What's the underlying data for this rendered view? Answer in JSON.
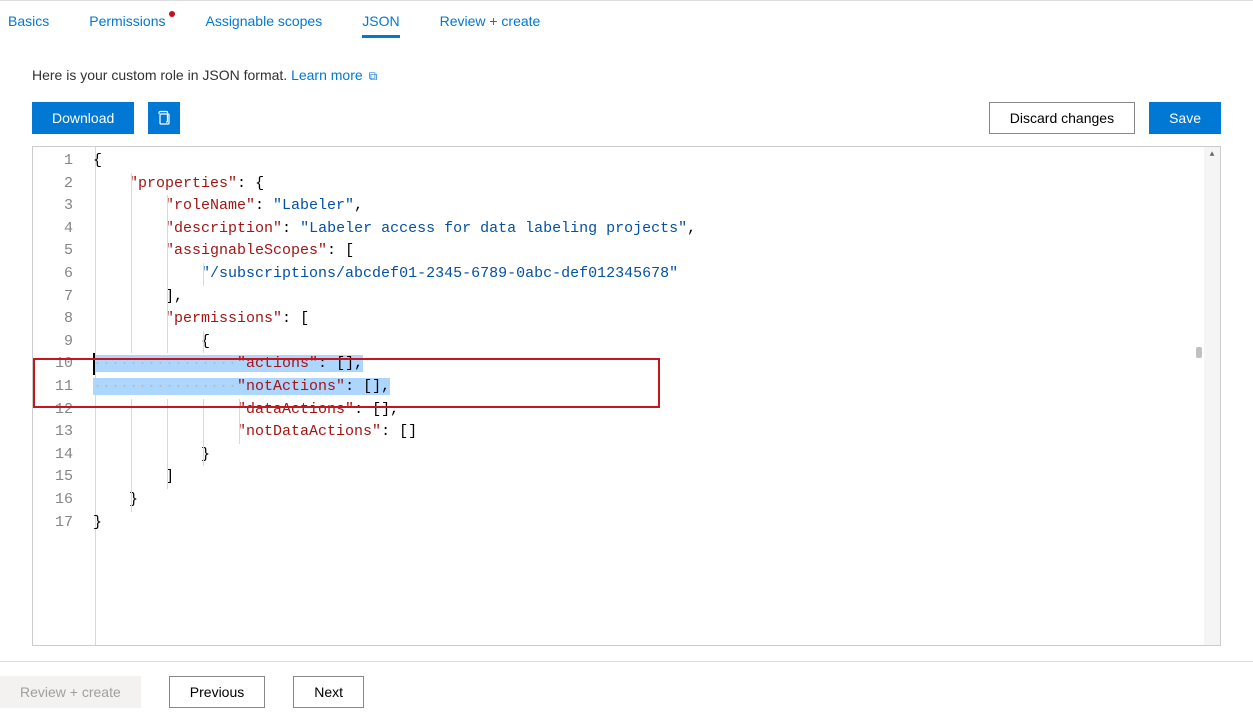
{
  "tabs": {
    "basics": "Basics",
    "permissions": "Permissions",
    "assignable_scopes": "Assignable scopes",
    "json": "JSON",
    "review_create": "Review + create"
  },
  "subheading": {
    "text": "Here is your custom role in JSON format. ",
    "link": "Learn more"
  },
  "buttons": {
    "download": "Download",
    "discard": "Discard changes",
    "save": "Save"
  },
  "editor": {
    "line_numbers": [
      "1",
      "2",
      "3",
      "4",
      "5",
      "6",
      "7",
      "8",
      "9",
      "10",
      "11",
      "12",
      "13",
      "14",
      "15",
      "16",
      "17"
    ],
    "json_content": {
      "properties": {
        "roleName": "Labeler",
        "description": "Labeler access for data labeling projects",
        "assignableScopes": [
          "/subscriptions/abcdef01-2345-6789-0abc-def012345678"
        ],
        "permissions": [
          {
            "actions": [],
            "notActions": [],
            "dataActions": [],
            "notDataActions": []
          }
        ]
      }
    },
    "tokens": {
      "open_brace": "{",
      "close_brace": "}",
      "open_bracket": "[",
      "close_bracket": "]",
      "comma": ",",
      "colon_space": ": ",
      "k_properties": "\"properties\"",
      "k_roleName": "\"roleName\"",
      "v_roleName": "\"Labeler\"",
      "k_description": "\"description\"",
      "v_description": "\"Labeler access for data labeling projects\"",
      "k_assignableScopes": "\"assignableScopes\"",
      "v_scope": "\"/subscriptions/abcdef01-2345-6789-0abc-def012345678\"",
      "k_permissions": "\"permissions\"",
      "k_actions": "\"actions\"",
      "k_notActions": "\"notActions\"",
      "k_dataActions": "\"dataActions\"",
      "k_notDataActions": "\"notDataActions\"",
      "dots": "················"
    }
  },
  "footer": {
    "review_create": "Review + create",
    "previous": "Previous",
    "next": "Next"
  }
}
